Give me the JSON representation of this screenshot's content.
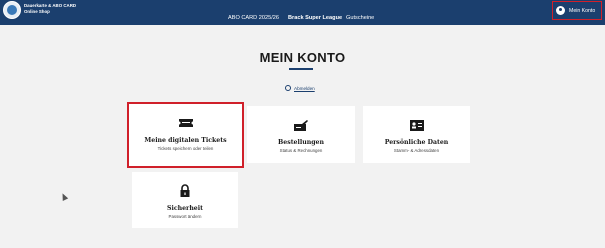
{
  "header": {
    "brand_line1": "Dauerkarte & ABO CARD",
    "brand_line2": "Online Shop",
    "nav": [
      {
        "label": "ABO CARD 2025/26",
        "active": false
      },
      {
        "label": "Brack Super League",
        "active": true
      },
      {
        "label": "Gutscheine",
        "active": false
      }
    ],
    "account_label": "Mein Konto",
    "account_icon": "user-icon"
  },
  "main": {
    "title": "MEIN KONTO",
    "logout_label": "Abmelden",
    "cards": [
      {
        "title": "Meine digitalen Tickets",
        "subtitle": "Tickets speichern oder teilen",
        "icon": "ticket-icon"
      },
      {
        "title": "Bestellungen",
        "subtitle": "Status & Rechnungen",
        "icon": "order-icon"
      },
      {
        "title": "Persönliche Daten",
        "subtitle": "Stamm- & Adressdaten",
        "icon": "id-card-icon"
      },
      {
        "title": "Sicherheit",
        "subtitle": "Passwort ändern",
        "icon": "lock-icon"
      }
    ]
  },
  "colors": {
    "header_bg": "#1b3f6e",
    "highlight": "#d0202a",
    "page_bg": "#f2f2f2"
  }
}
